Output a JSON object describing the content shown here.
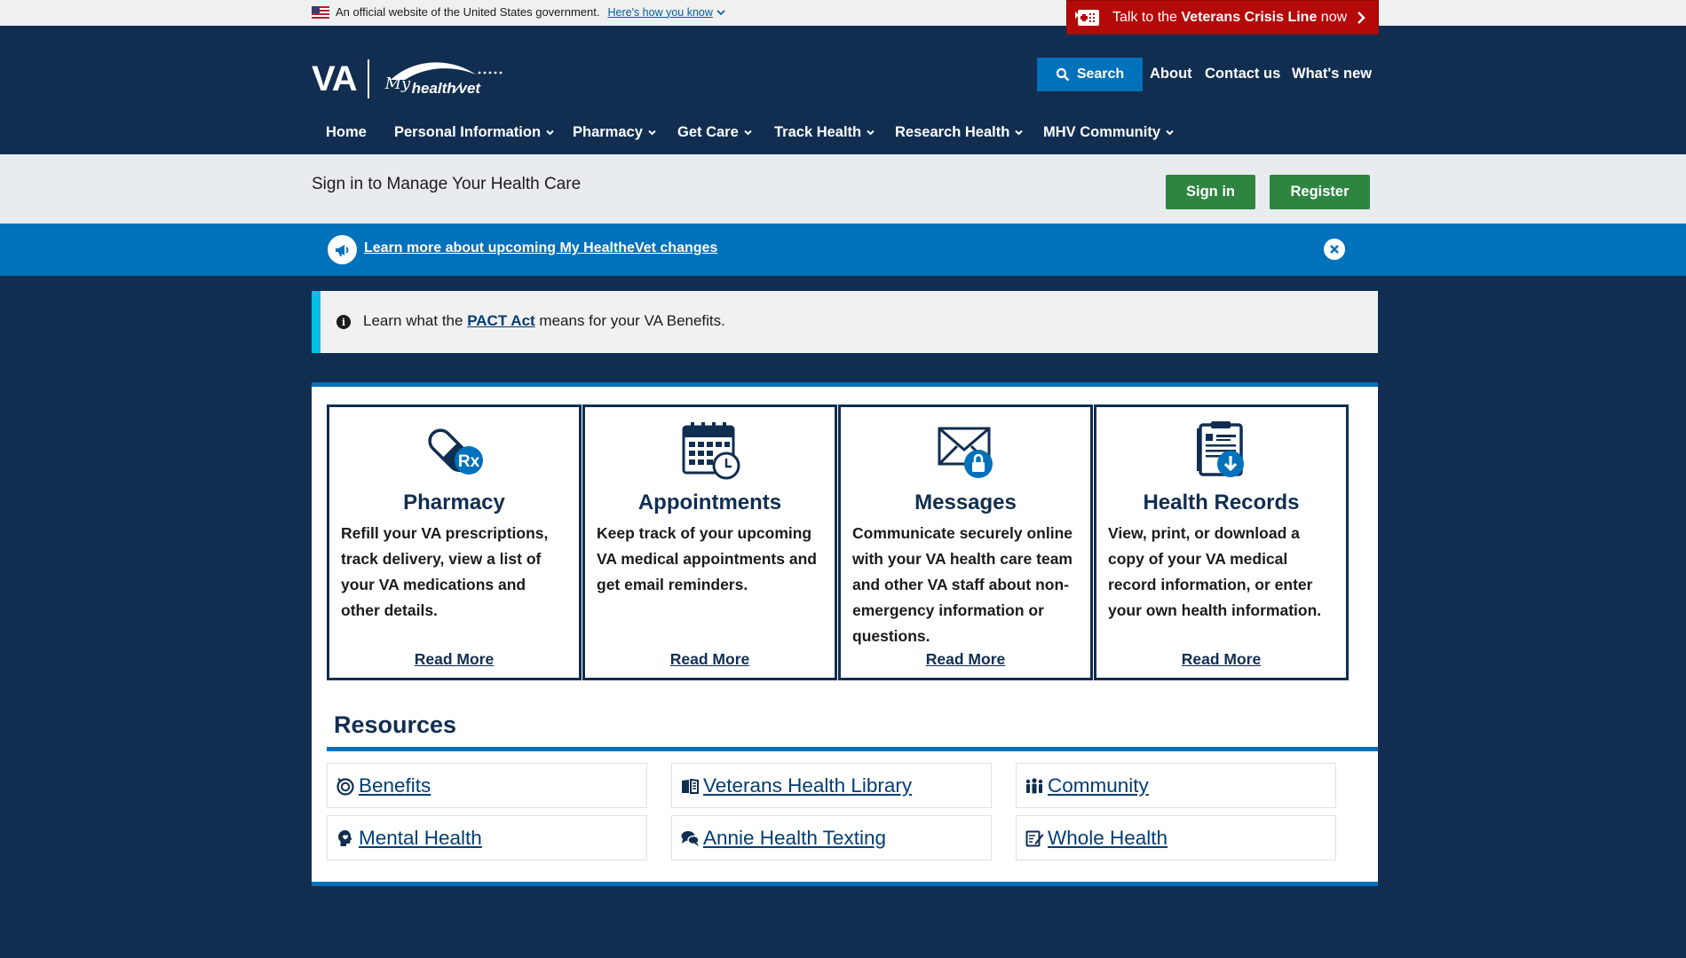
{
  "gov_banner": {
    "text": "An official website of the United States government.",
    "link": "Here's how you know"
  },
  "crisis_line": {
    "prefix": "Talk to the ",
    "bold": "Veterans Crisis Line",
    "suffix": " now"
  },
  "logo": {
    "va": "VA",
    "my": "My",
    "healthevet": "health⁄vet"
  },
  "header": {
    "search_label": "Search",
    "links": [
      "About",
      "Contact us",
      "What's new"
    ]
  },
  "nav": [
    "Home",
    "Personal Information",
    "Pharmacy",
    "Get Care",
    "Track Health",
    "Research Health",
    "MHV Community"
  ],
  "signin": {
    "label": "Sign in to Manage Your Health Care",
    "signin_button": "Sign in",
    "register_button": "Register"
  },
  "promo": {
    "link": "Learn more about upcoming My HealtheVet changes"
  },
  "alert": {
    "before": "Learn what the ",
    "link": "PACT Act",
    "after": " means for your VA Benefits."
  },
  "cards": [
    {
      "title": "Pharmacy",
      "text": "Refill your VA prescriptions, track delivery, view a list of your VA medications and other details.",
      "more": "Read More",
      "icon": "pill-rx-icon"
    },
    {
      "title": "Appointments",
      "text": "Keep track of your upcoming VA medical appointments and get email reminders.",
      "more": "Read More",
      "icon": "calendar-clock-icon"
    },
    {
      "title": "Messages",
      "text": "Communicate securely online with your VA health care team and other VA staff about non-emergency information or questions.",
      "more": "Read More",
      "icon": "envelope-lock-icon"
    },
    {
      "title": "Health Records",
      "text": "View, print, or download a copy of your VA medical record information, or enter your own health information.",
      "more": "Read More",
      "icon": "record-download-icon"
    }
  ],
  "resources": {
    "title": "Resources",
    "items": [
      {
        "label": "Benefits",
        "icon": "benefits-icon"
      },
      {
        "label": "Veterans Health Library",
        "icon": "book-icon"
      },
      {
        "label": "Community",
        "icon": "community-icon"
      },
      {
        "label": "Mental Health",
        "icon": "head-icon"
      },
      {
        "label": "Annie Health Texting",
        "icon": "chat-icon"
      },
      {
        "label": "Whole Health",
        "icon": "notepad-icon"
      }
    ]
  },
  "colors": {
    "navy": "#112e51",
    "blue": "#0071bb",
    "green": "#2e8540",
    "crisis_red": "#b50909",
    "alert_accent": "#02bfe7"
  }
}
